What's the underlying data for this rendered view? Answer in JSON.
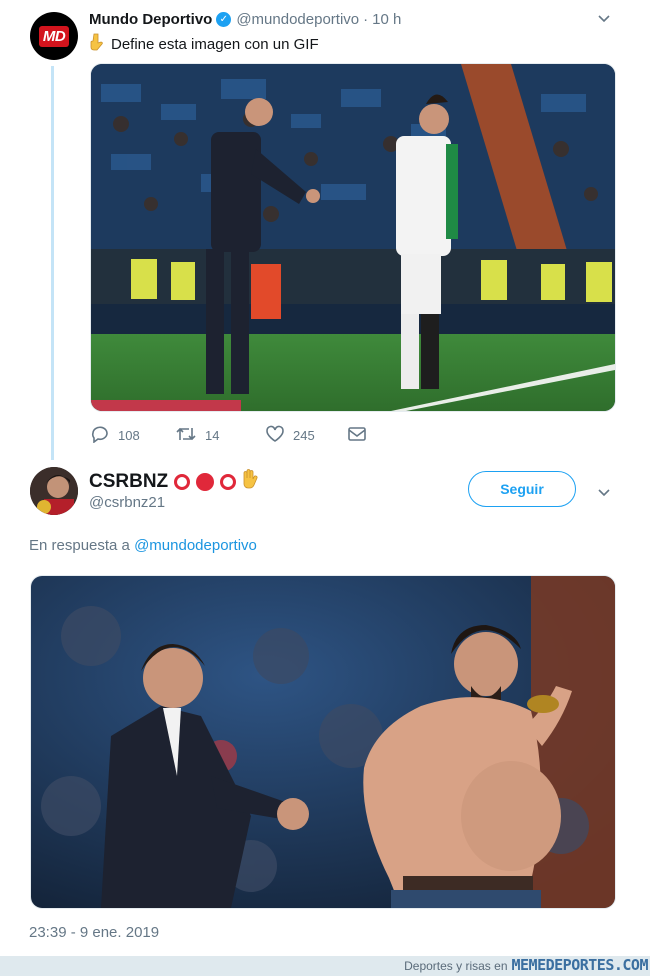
{
  "colors": {
    "accent": "#1da1f2",
    "link": "#1b95e0",
    "muted": "#657786",
    "thread_line": "#c4e4f7",
    "md_red": "#d3141d"
  },
  "tweet1": {
    "avatar_logo": "MD",
    "name": "Mundo Deportivo",
    "handle": "@mundodeportivo",
    "separator": "·",
    "time": "10 h",
    "text": "Define esta imagen con un GIF",
    "text_icon": "pointing-down-hand-icon",
    "actions": {
      "replies": "108",
      "retweets": "14",
      "likes": "245"
    }
  },
  "tweet2": {
    "name": "CSRBNZ",
    "handle": "@csrbnz21",
    "follow_label": "Seguir",
    "reply_prefix": "En respuesta a",
    "reply_handle": "@mundodeportivo",
    "timestamp": "23:39 - 9 ene. 2019"
  },
  "footer": {
    "prefix": "Deportes y risas en",
    "brand": "MEMEDEPORTES.COM"
  }
}
